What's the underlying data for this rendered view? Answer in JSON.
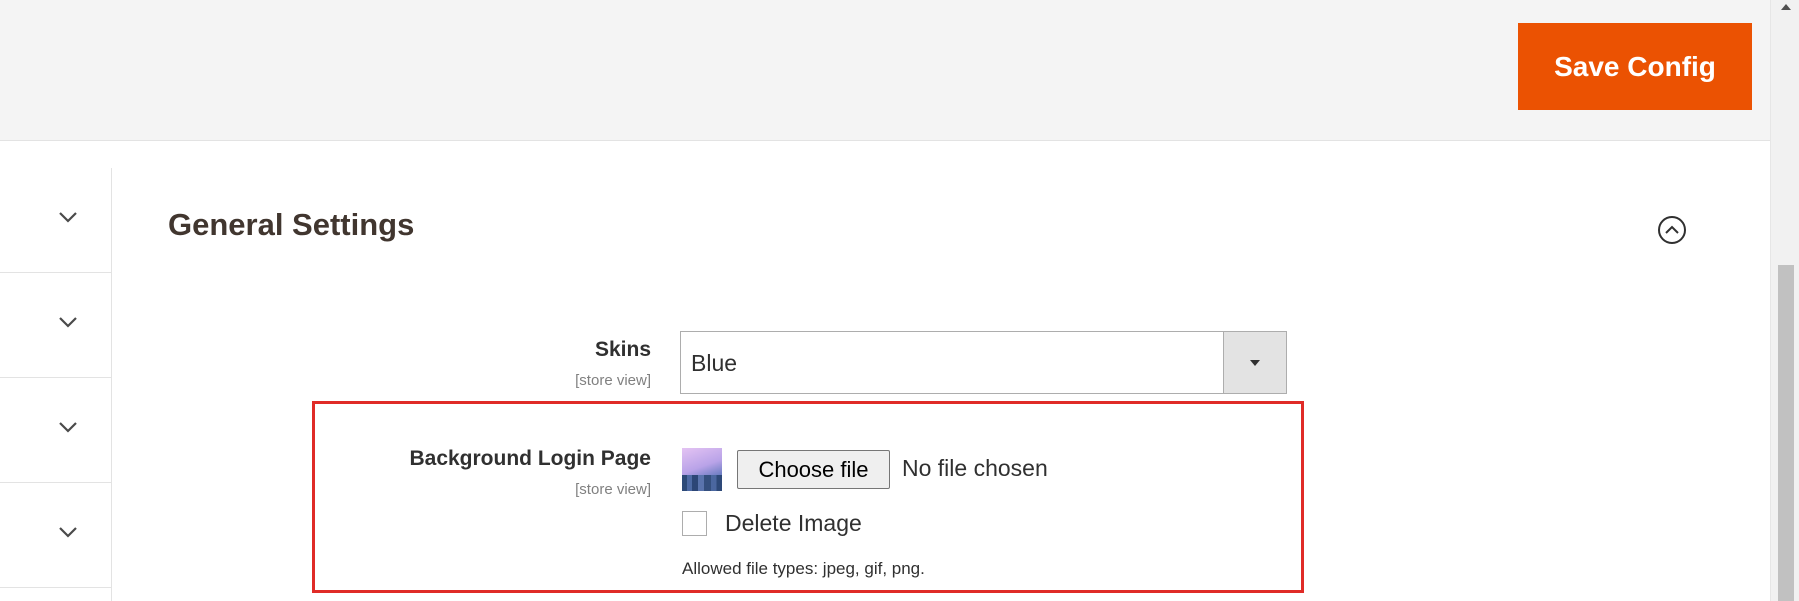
{
  "header": {
    "save_button_label": "Save Config"
  },
  "sidebar": {
    "items": [
      {
        "icon": "chevron-down-icon"
      },
      {
        "icon": "chevron-down-icon"
      },
      {
        "icon": "chevron-down-icon"
      },
      {
        "icon": "chevron-down-icon"
      }
    ]
  },
  "section": {
    "title": "General Settings",
    "collapse_icon": "chevron-up-circle-icon"
  },
  "fields": {
    "skins": {
      "label": "Skins",
      "scope": "[store view]",
      "selected_value": "Blue"
    },
    "background_login_page": {
      "label": "Background Login Page",
      "scope": "[store view]",
      "choose_file_label": "Choose file",
      "file_status": "No file chosen",
      "delete_image_label": "Delete Image",
      "delete_image_checked": false,
      "note": "Allowed file types: jpeg, gif, png."
    }
  },
  "colors": {
    "accent": "#eb5202",
    "highlight_border": "#e02b27"
  }
}
